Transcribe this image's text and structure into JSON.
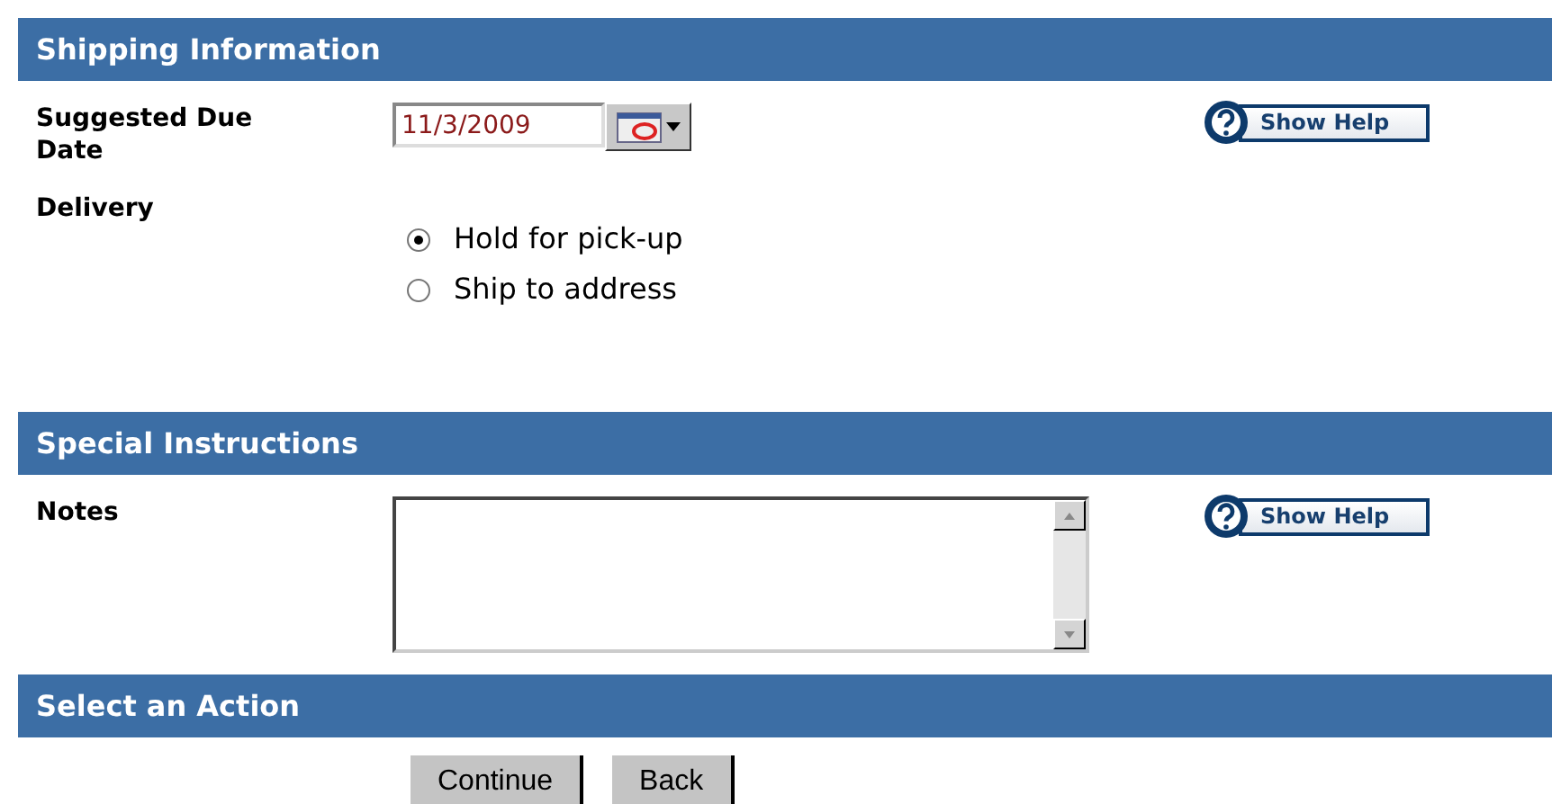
{
  "sections": [
    {
      "title": "Shipping Information",
      "rows": [
        {
          "kind": "date",
          "label": "Suggested Due Date",
          "value": "11/3/2009",
          "help": "Show Help"
        },
        {
          "kind": "radios",
          "label": "Delivery",
          "options": [
            {
              "label": "Hold for pick-up",
              "selected": true
            },
            {
              "label": "Ship to address",
              "selected": false
            }
          ]
        }
      ]
    },
    {
      "title": "Special Instructions",
      "rows": [
        {
          "kind": "textarea",
          "label": "Notes",
          "help": "Show Help"
        }
      ]
    },
    {
      "title": "Select an Action",
      "rows": [
        {
          "kind": "buttons",
          "buttons": [
            "Continue",
            "Back"
          ]
        }
      ]
    }
  ]
}
